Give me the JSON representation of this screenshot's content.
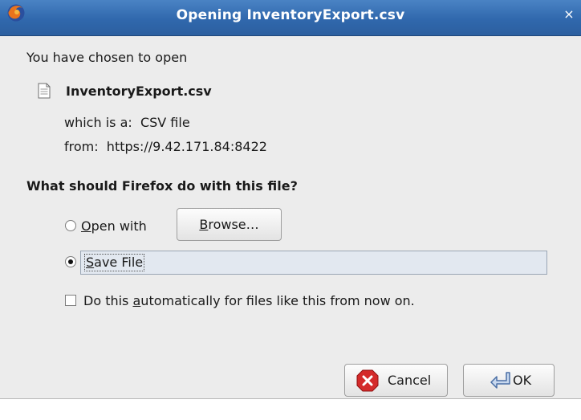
{
  "window": {
    "title": "Opening InventoryExport.csv",
    "app_icon": "firefox-icon",
    "close_glyph": "×"
  },
  "dialog": {
    "intro": "You have chosen to open",
    "file_icon": "document-icon",
    "filename": "InventoryExport.csv",
    "type_label": "which is a:",
    "type_value": "CSV file",
    "from_label": "from:",
    "from_value": "https://9.42.171.84:8422",
    "question": "What should Firefox do with this file?"
  },
  "options": {
    "open_with": {
      "mnemonic": "O",
      "rest": "pen with",
      "selected": false
    },
    "browse_button": {
      "mnemonic": "B",
      "rest": "rowse…"
    },
    "save_file": {
      "mnemonic": "S",
      "rest": "ave File",
      "selected": true
    },
    "auto": {
      "before": "Do this ",
      "mnemonic": "a",
      "after": "utomatically for files like this from now on.",
      "checked": false
    }
  },
  "buttons": {
    "cancel": {
      "label": "Cancel",
      "icon": "cancel-icon"
    },
    "ok": {
      "label": "OK",
      "icon": "ok-arrow-icon"
    }
  },
  "colors": {
    "titlebar": "#3068ad",
    "dialog_bg": "#ececec",
    "selection_bg": "#e2e8f0",
    "cancel_red": "#d42a2a"
  }
}
